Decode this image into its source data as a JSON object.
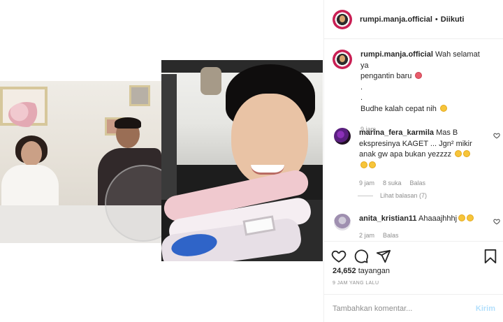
{
  "header": {
    "username": "rumpi.manja.official",
    "separator": "•",
    "follow_status": "Diikuti"
  },
  "comments": [
    {
      "username": "rumpi.manja.official",
      "text_lines": [
        "Wah selamat ya",
        "pengantin baru",
        ".",
        ".",
        "Budhe kalah cepat nih"
      ],
      "time": "9 jam"
    },
    {
      "username": "marina_fera_karmila",
      "text": "Mas B ekspresinya KAGET ... Jgn² mikir anak gw apa bukan yezzzz",
      "time": "9 jam",
      "likes": "8 suka",
      "reply_label": "Balas",
      "view_replies": "Lihat balasan (7)"
    },
    {
      "username": "anita_kristian11",
      "text": "Ahaaajhhhj",
      "time": "2 jam",
      "reply_label": "Balas"
    }
  ],
  "stats": {
    "views": "24,652",
    "views_label": "tayangan",
    "time_ago": "9 JAM YANG LALU"
  },
  "add_comment": {
    "placeholder": "Tambahkan komentar...",
    "post_label": "Kirim"
  },
  "colors": {
    "text": "#262626",
    "muted": "#8e8e8e",
    "border": "#efefef",
    "post_disabled": "#b2dffc",
    "avatar_ring": "#c91f54"
  },
  "icons": [
    "heart-icon",
    "comment-icon",
    "share-icon",
    "save-icon",
    "like-comment-icon"
  ]
}
